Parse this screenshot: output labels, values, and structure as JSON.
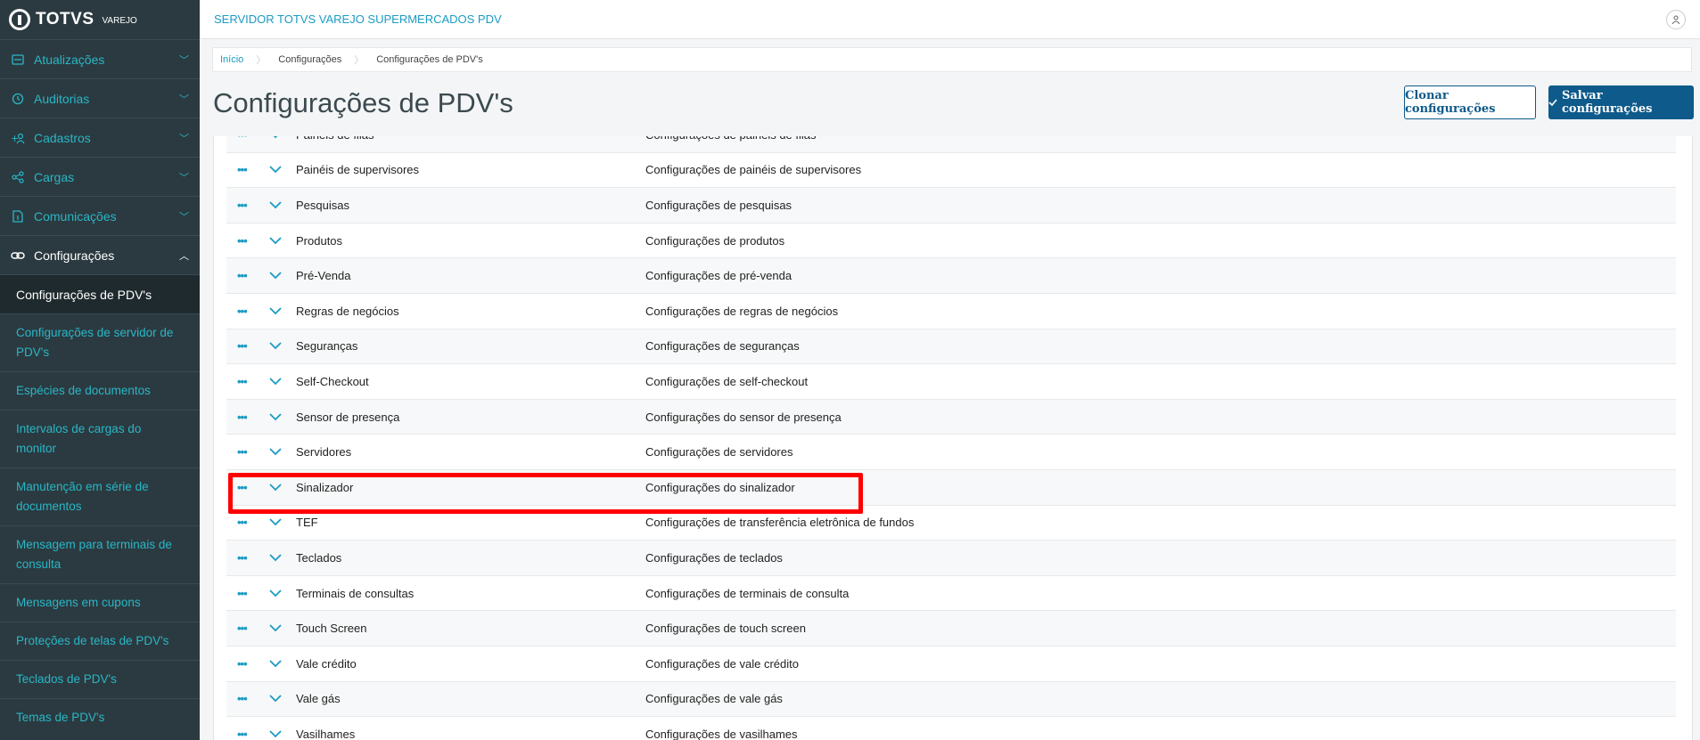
{
  "brand": {
    "name": "TOTVS",
    "sub": "VAREJO"
  },
  "header": {
    "server": "SERVIDOR TOTVS VAREJO SUPERMERCADOS PDV",
    "user_icon": "user-icon"
  },
  "sidebar": {
    "items": [
      {
        "label": "Atualizações",
        "icon": "update-icon"
      },
      {
        "label": "Auditorias",
        "icon": "history-icon"
      },
      {
        "label": "Cadastros",
        "icon": "add-user-icon"
      },
      {
        "label": "Cargas",
        "icon": "share-icon"
      },
      {
        "label": "Comunicações",
        "icon": "document-icon"
      },
      {
        "label": "Configurações",
        "icon": "link-icon"
      }
    ],
    "active_sub": "Configurações de PDV's",
    "sub_items": [
      "Configurações de servidor de PDV's",
      "Espécies de documentos",
      "Intervalos de cargas do monitor",
      "Manutenção em série de documentos",
      "Mensagem para terminais de consulta",
      "Mensagens em cupons",
      "Proteções de telas de PDV's",
      "Teclados de PDV's",
      "Temas de PDV's"
    ]
  },
  "breadcrumb": [
    "Início",
    "Configurações",
    "Configurações de PDV's"
  ],
  "page": {
    "title": "Configurações de PDV's",
    "clone_label": "Clonar configurações",
    "save_label": "Salvar configurações"
  },
  "table": {
    "rows": [
      {
        "name": "Painéis de filas",
        "desc": "Configurações de painéis de filas"
      },
      {
        "name": "Painéis de supervisores",
        "desc": "Configurações de painéis de supervisores"
      },
      {
        "name": "Pesquisas",
        "desc": "Configurações de pesquisas"
      },
      {
        "name": "Produtos",
        "desc": "Configurações de produtos"
      },
      {
        "name": "Pré-Venda",
        "desc": "Configurações de pré-venda"
      },
      {
        "name": "Regras de negócios",
        "desc": "Configurações de regras de negócios"
      },
      {
        "name": "Seguranças",
        "desc": "Configurações de seguranças"
      },
      {
        "name": "Self-Checkout",
        "desc": "Configurações de self-checkout"
      },
      {
        "name": "Sensor de presença",
        "desc": "Configurações do sensor de presença"
      },
      {
        "name": "Servidores",
        "desc": "Configurações de servidores"
      },
      {
        "name": "Sinalizador",
        "desc": "Configurações do sinalizador"
      },
      {
        "name": "TEF",
        "desc": "Configurações de transferência eletrônica de fundos"
      },
      {
        "name": "Teclados",
        "desc": "Configurações de teclados"
      },
      {
        "name": "Terminais de consultas",
        "desc": "Configurações de terminais de consulta"
      },
      {
        "name": "Touch Screen",
        "desc": "Configurações de touch screen"
      },
      {
        "name": "Vale crédito",
        "desc": "Configurações de vale crédito"
      },
      {
        "name": "Vale gás",
        "desc": "Configurações de vale gás"
      },
      {
        "name": "Vasilhames",
        "desc": "Configurações de vasilhames"
      }
    ]
  },
  "colors": {
    "accent": "#1b9bc4",
    "primary": "#0e5a8a",
    "sidebar": "#2b3a40",
    "highlight": "#ff0000"
  }
}
